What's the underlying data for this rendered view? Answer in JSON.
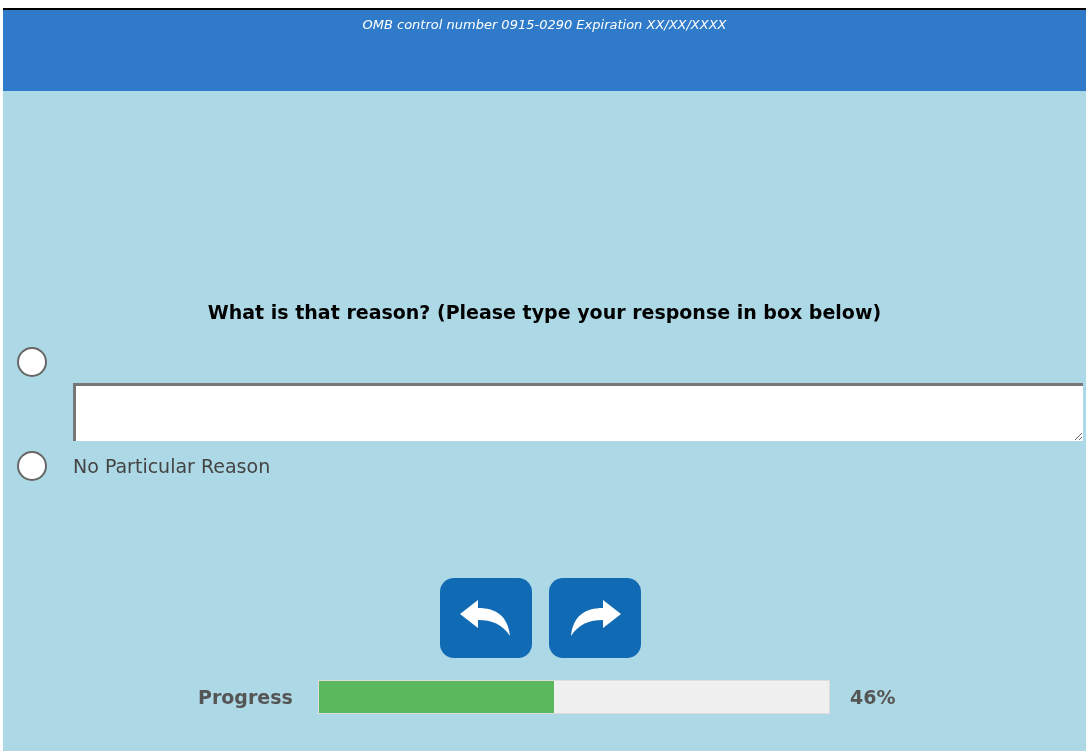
{
  "header": {
    "notice": "OMB control number 0915-0290 Expiration XX/XX/XXXX"
  },
  "question": {
    "prompt": "What is that reason? (Please type your response in box below)",
    "options": [
      {
        "kind": "text-entry",
        "selected": false
      },
      {
        "kind": "label",
        "selected": false,
        "label": "No Particular Reason"
      }
    ]
  },
  "progress": {
    "label": "Progress",
    "level": 0.46,
    "reading": "46%"
  }
}
